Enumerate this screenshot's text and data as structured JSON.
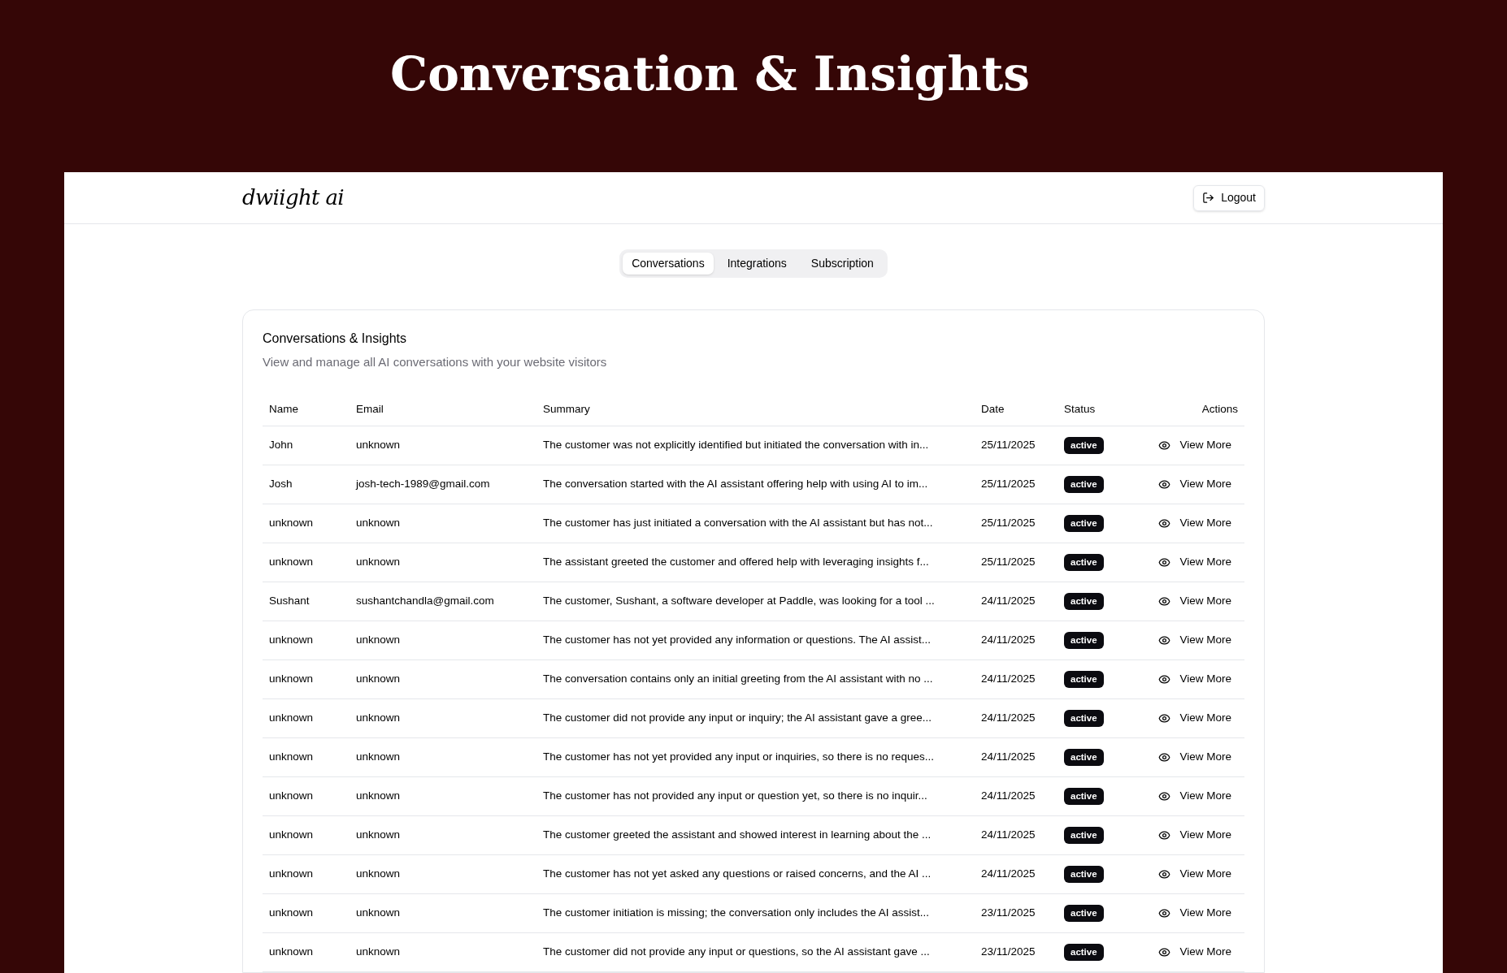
{
  "page_title": "Conversation & Insights",
  "logo": "dwiight ai",
  "logout": "Logout",
  "tabs": [
    {
      "label": "Conversations",
      "selected": true
    },
    {
      "label": "Integrations",
      "selected": false
    },
    {
      "label": "Subscription",
      "selected": false
    }
  ],
  "card": {
    "title": "Conversations & Insights",
    "subtitle": "View and manage all AI conversations with your website visitors"
  },
  "table": {
    "columns": [
      "Name",
      "Email",
      "Summary",
      "Date",
      "Status",
      "Actions"
    ],
    "rows": [
      {
        "name": "John",
        "email": "unknown",
        "summary": "The customer was not explicitly identified but initiated the conversation with in...",
        "date": "25/11/2025",
        "status": "active",
        "action": "View More"
      },
      {
        "name": "Josh",
        "email": "josh-tech-1989@gmail.com",
        "summary": "The conversation started with the AI assistant offering help with using AI to im...",
        "date": "25/11/2025",
        "status": "active",
        "action": "View More"
      },
      {
        "name": "unknown",
        "email": "unknown",
        "summary": "The customer has just initiated a conversation with the AI assistant but has not...",
        "date": "25/11/2025",
        "status": "active",
        "action": "View More"
      },
      {
        "name": "unknown",
        "email": "unknown",
        "summary": "The assistant greeted the customer and offered help with leveraging insights f...",
        "date": "25/11/2025",
        "status": "active",
        "action": "View More"
      },
      {
        "name": "Sushant",
        "email": "sushantchandla@gmail.com",
        "summary": "The customer, Sushant, a software developer at Paddle, was looking for a tool ...",
        "date": "24/11/2025",
        "status": "active",
        "action": "View More"
      },
      {
        "name": "unknown",
        "email": "unknown",
        "summary": "The customer has not yet provided any information or questions. The AI assist...",
        "date": "24/11/2025",
        "status": "active",
        "action": "View More"
      },
      {
        "name": "unknown",
        "email": "unknown",
        "summary": "The conversation contains only an initial greeting from the AI assistant with no ...",
        "date": "24/11/2025",
        "status": "active",
        "action": "View More"
      },
      {
        "name": "unknown",
        "email": "unknown",
        "summary": "The customer did not provide any input or inquiry; the AI assistant gave a gree...",
        "date": "24/11/2025",
        "status": "active",
        "action": "View More"
      },
      {
        "name": "unknown",
        "email": "unknown",
        "summary": "The customer has not yet provided any input or inquiries, so there is no reques...",
        "date": "24/11/2025",
        "status": "active",
        "action": "View More"
      },
      {
        "name": "unknown",
        "email": "unknown",
        "summary": "The customer has not provided any input or question yet, so there is no inquir...",
        "date": "24/11/2025",
        "status": "active",
        "action": "View More"
      },
      {
        "name": "unknown",
        "email": "unknown",
        "summary": "The customer greeted the assistant and showed interest in learning about the ...",
        "date": "24/11/2025",
        "status": "active",
        "action": "View More"
      },
      {
        "name": "unknown",
        "email": "unknown",
        "summary": "The customer has not yet asked any questions or raised concerns, and the AI ...",
        "date": "24/11/2025",
        "status": "active",
        "action": "View More"
      },
      {
        "name": "unknown",
        "email": "unknown",
        "summary": "The customer initiation is missing; the conversation only includes the AI assist...",
        "date": "23/11/2025",
        "status": "active",
        "action": "View More"
      },
      {
        "name": "unknown",
        "email": "unknown",
        "summary": "The customer did not provide any input or questions, so the AI assistant gave ...",
        "date": "23/11/2025",
        "status": "active",
        "action": "View More"
      }
    ]
  }
}
